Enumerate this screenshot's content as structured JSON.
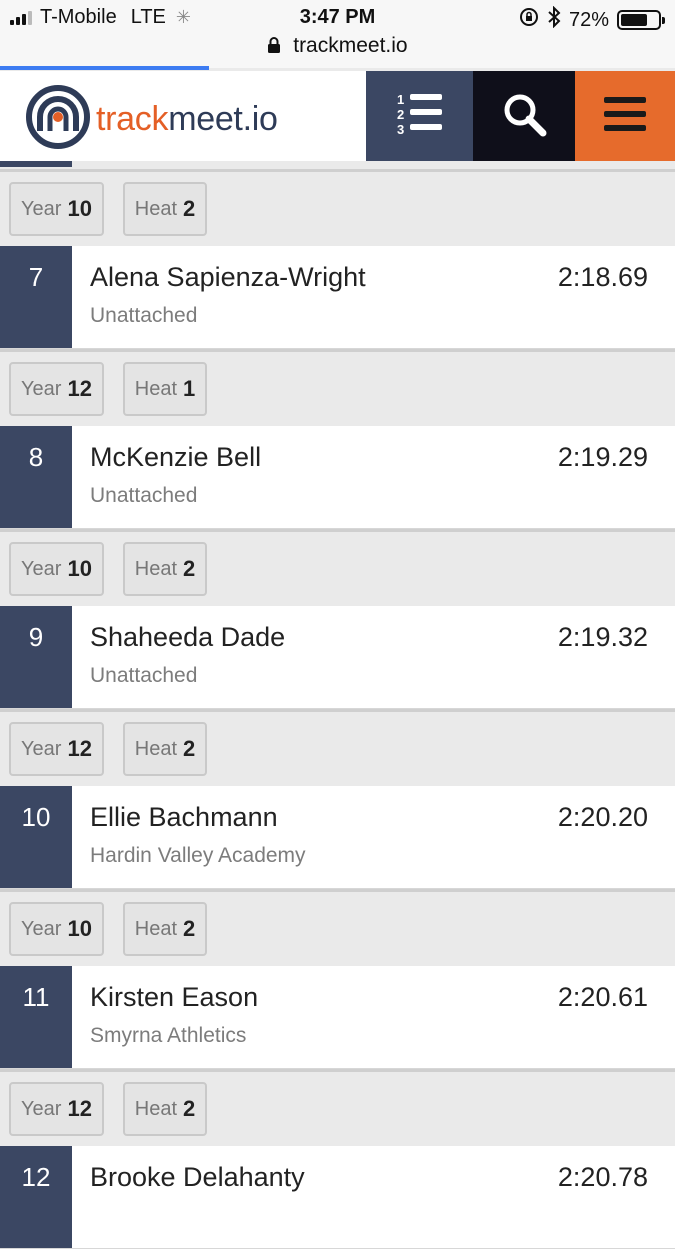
{
  "status_bar": {
    "carrier": "T-Mobile",
    "network": "LTE",
    "time": "3:47 PM",
    "battery": "72%",
    "battery_level": 0.72
  },
  "browser": {
    "url": "trackmeet.io",
    "load_progress": 0.31
  },
  "header": {
    "logo_part1": "track",
    "logo_part2": "meet.io",
    "rank_button_icon": "ranking-list-icon",
    "search_button_icon": "search-icon",
    "menu_button_icon": "hamburger-menu-icon"
  },
  "labels": {
    "year": "Year",
    "heat": "Heat"
  },
  "top_tags": {
    "year": "10",
    "heat": "2"
  },
  "results": [
    {
      "place": "7",
      "name": "Alena Sapienza-Wright",
      "team": "Unattached",
      "mark": "2:18.69",
      "year": "12",
      "heat": "1"
    },
    {
      "place": "8",
      "name": "McKenzie Bell",
      "team": "Unattached",
      "mark": "2:19.29",
      "year": "10",
      "heat": "2"
    },
    {
      "place": "9",
      "name": "Shaheeda Dade",
      "team": "Unattached",
      "mark": "2:19.32",
      "year": "12",
      "heat": "2"
    },
    {
      "place": "10",
      "name": "Ellie Bachmann",
      "team": "Hardin Valley Academy",
      "mark": "2:20.20",
      "year": "10",
      "heat": "2"
    },
    {
      "place": "11",
      "name": "Kirsten Eason",
      "team": "Smyrna Athletics",
      "mark": "2:20.61",
      "year": "12",
      "heat": "2"
    },
    {
      "place": "12",
      "name": "Brooke Delahanty",
      "team": "",
      "mark": "2:20.78",
      "year": "",
      "heat": ""
    }
  ],
  "colors": {
    "brand_orange": "#e45f26",
    "brand_navy": "#2e3b57",
    "place_bg": "#3b4763",
    "search_bg": "#0f0f1a",
    "menu_bg": "#e66b2c"
  }
}
